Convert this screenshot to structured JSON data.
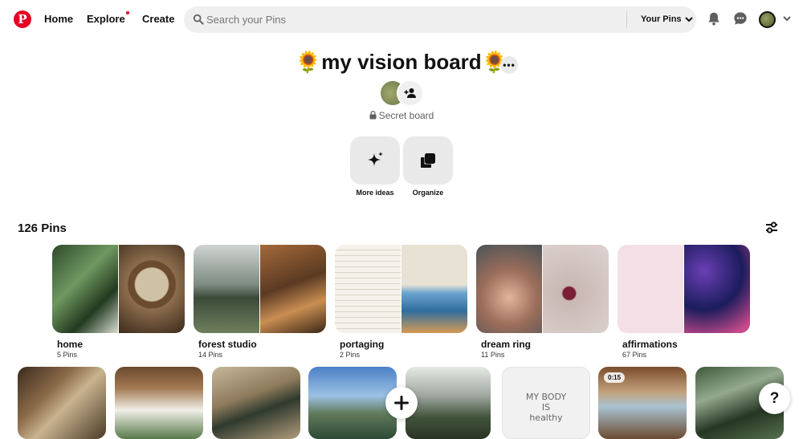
{
  "nav": {
    "logo": "P",
    "home": "Home",
    "explore": "Explore",
    "create": "Create"
  },
  "search": {
    "placeholder": "Search your Pins",
    "scope_label": "Your Pins"
  },
  "board": {
    "title": "🌻my vision board🌻",
    "privacy": "Secret board"
  },
  "actions": {
    "more_ideas": "More ideas",
    "organize": "Organize"
  },
  "pins_count": "126 Pins",
  "sections": [
    {
      "name": "home",
      "count": "5 Pins"
    },
    {
      "name": "forest studio",
      "count": "14 Pins"
    },
    {
      "name": "portaging",
      "count": "2 Pins"
    },
    {
      "name": "dream ring",
      "count": "11 Pins"
    },
    {
      "name": "affirmations",
      "count": "67 Pins"
    }
  ],
  "pins": {
    "video_badge": "0:15",
    "text_pin": "MY BODY\nIS\nhealthy"
  },
  "fab": {
    "help": "?"
  },
  "colors": {
    "brand": "#e60023"
  }
}
